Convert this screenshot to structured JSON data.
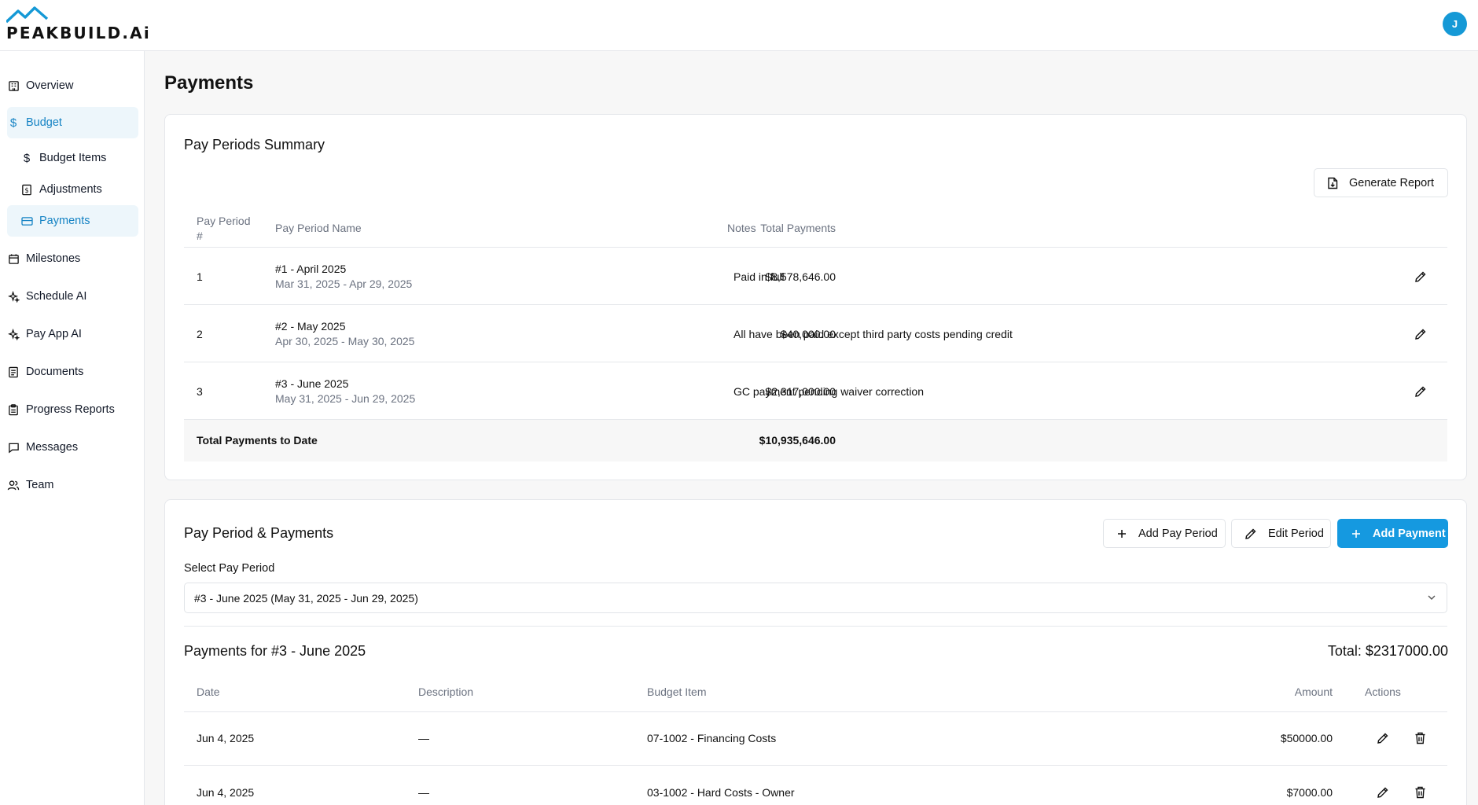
{
  "brand": {
    "name": "PEAKBUILD.Ai",
    "avatar_initial": "J",
    "accent": "#1599e0"
  },
  "sidebar": {
    "items": [
      {
        "label": "Overview"
      },
      {
        "label": "Budget"
      },
      {
        "label": "Budget Items"
      },
      {
        "label": "Adjustments"
      },
      {
        "label": "Payments"
      },
      {
        "label": "Milestones"
      },
      {
        "label": "Schedule AI"
      },
      {
        "label": "Pay App AI"
      },
      {
        "label": "Documents"
      },
      {
        "label": "Progress Reports"
      },
      {
        "label": "Messages"
      },
      {
        "label": "Team"
      }
    ]
  },
  "page": {
    "title": "Payments"
  },
  "summary": {
    "title": "Pay Periods Summary",
    "generate_label": "Generate Report",
    "columns": {
      "num": "Pay Period #",
      "name": "Pay Period Name",
      "total": "Total Payments",
      "notes": "Notes"
    },
    "rows": [
      {
        "num": "1",
        "name": "#1 - April 2025",
        "range": "Mar 31, 2025 - Apr 29, 2025",
        "total": "$8,578,646.00",
        "notes": "Paid in full"
      },
      {
        "num": "2",
        "name": "#2 - May 2025",
        "range": "Apr 30, 2025 - May 30, 2025",
        "total": "$40,000.00",
        "notes": "All have been paid except third party costs pending credit"
      },
      {
        "num": "3",
        "name": "#3 - June 2025",
        "range": "May 31, 2025 - Jun 29, 2025",
        "total": "$2,317,000.00",
        "notes": "GC payment pending waiver correction"
      }
    ],
    "total_label": "Total Payments to Date",
    "total_value": "$10,935,646.00"
  },
  "period": {
    "title": "Pay Period & Payments",
    "add_period_label": "Add Pay Period",
    "edit_period_label": "Edit Period",
    "add_payment_label": "Add Payment",
    "select_label": "Select Pay Period",
    "select_value": "#3 - June 2025 (May 31, 2025 - Jun 29, 2025)",
    "payments_title": "Payments for #3 - June 2025",
    "payments_total": "Total: $2317000.00",
    "columns": {
      "date": "Date",
      "description": "Description",
      "budget_item": "Budget Item",
      "amount": "Amount",
      "actions": "Actions"
    },
    "rows": [
      {
        "date": "Jun 4, 2025",
        "description": "—",
        "budget_item": "07-1002 - Financing Costs",
        "amount": "$50000.00"
      },
      {
        "date": "Jun 4, 2025",
        "description": "—",
        "budget_item": "03-1002 - Hard Costs - Owner",
        "amount": "$7000.00"
      }
    ]
  }
}
